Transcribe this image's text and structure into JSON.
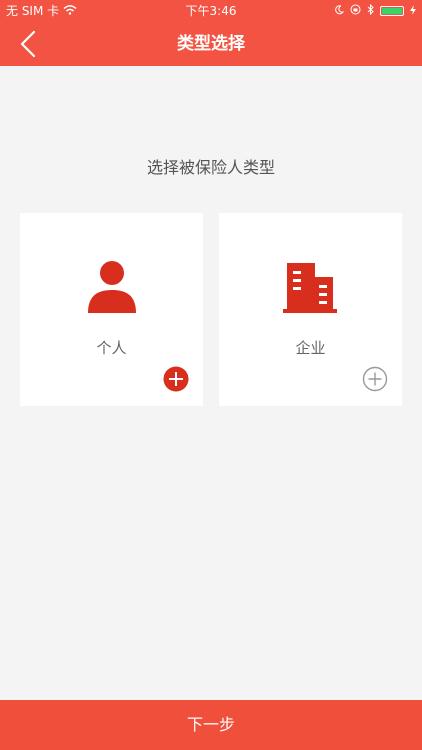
{
  "status_bar": {
    "carrier": "无 SIM 卡",
    "time": "下午3:46",
    "battery_percent": 100,
    "icons": [
      "wifi-icon",
      "moon-icon",
      "lock-rotation-icon",
      "bluetooth-icon",
      "battery-icon",
      "charging-icon"
    ]
  },
  "header": {
    "title": "类型选择",
    "back_icon": "back-arrow-icon"
  },
  "main": {
    "prompt": "选择被保险人类型",
    "options": [
      {
        "label": "个人",
        "icon": "person-icon",
        "add_icon": "plus-circle-filled-icon",
        "selected": true
      },
      {
        "label": "企业",
        "icon": "building-icon",
        "add_icon": "plus-circle-outline-icon",
        "selected": false
      }
    ]
  },
  "footer": {
    "next_label": "下一步"
  },
  "colors": {
    "brand_red": "#f35343",
    "icon_red": "#d82e1e",
    "background": "#f4f4f4",
    "card": "#ffffff",
    "inactive_plus": "#999999"
  }
}
